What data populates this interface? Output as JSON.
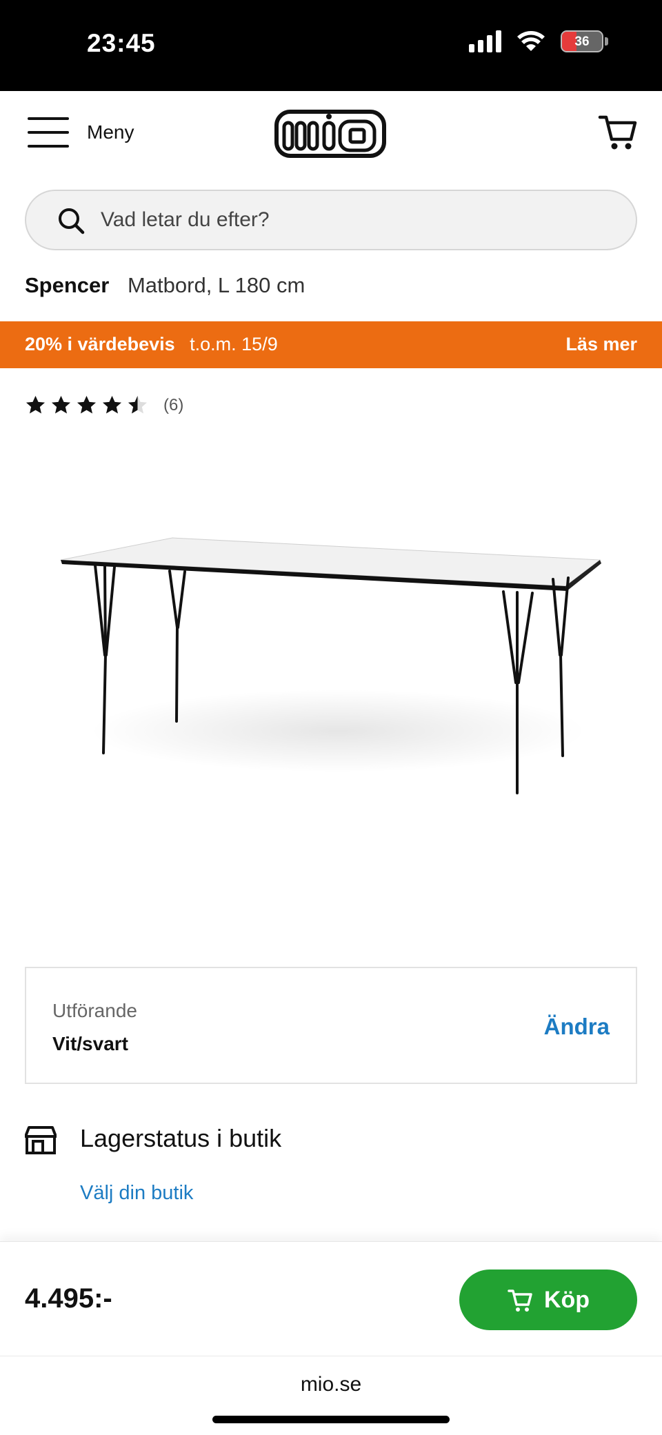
{
  "status_bar": {
    "time": "23:45",
    "battery": "36"
  },
  "header": {
    "menu_label": "Meny",
    "logo_text": "mio"
  },
  "search": {
    "placeholder": "Vad letar du efter?"
  },
  "product": {
    "brand": "Spencer",
    "description": "Matbord, L 180 cm"
  },
  "promo": {
    "highlight": "20% i värdebevis",
    "period": "t.o.m. 15/9",
    "link": "Läs mer",
    "color": "#ec6c12"
  },
  "rating": {
    "stars": 4.5,
    "max": 5,
    "count": "(6)"
  },
  "variant": {
    "label": "Utförande",
    "value": "Vit/svart",
    "change": "Ändra"
  },
  "stock": {
    "title": "Lagerstatus i butik",
    "link": "Välj din butik"
  },
  "buy": {
    "price": "4.495:-",
    "button_label": "Köp",
    "button_color": "#22a232"
  },
  "browser": {
    "url": "mio.se"
  },
  "colors": {
    "link": "#1d7cc3",
    "promo": "#ec6c12",
    "buy": "#22a232"
  }
}
